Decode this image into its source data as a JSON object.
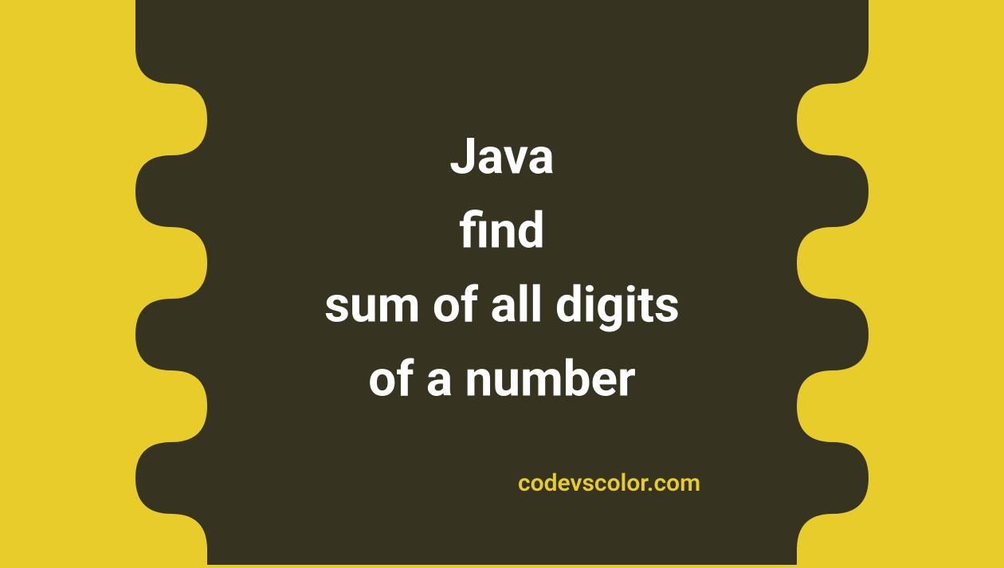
{
  "title_lines": "Java\nfind\nsum of all digits\nof a number",
  "watermark": "codevscolor.com",
  "colors": {
    "background": "#e8cd2a",
    "blob": "#363420",
    "text": "#ffffff",
    "watermark": "#e8cd2a"
  }
}
